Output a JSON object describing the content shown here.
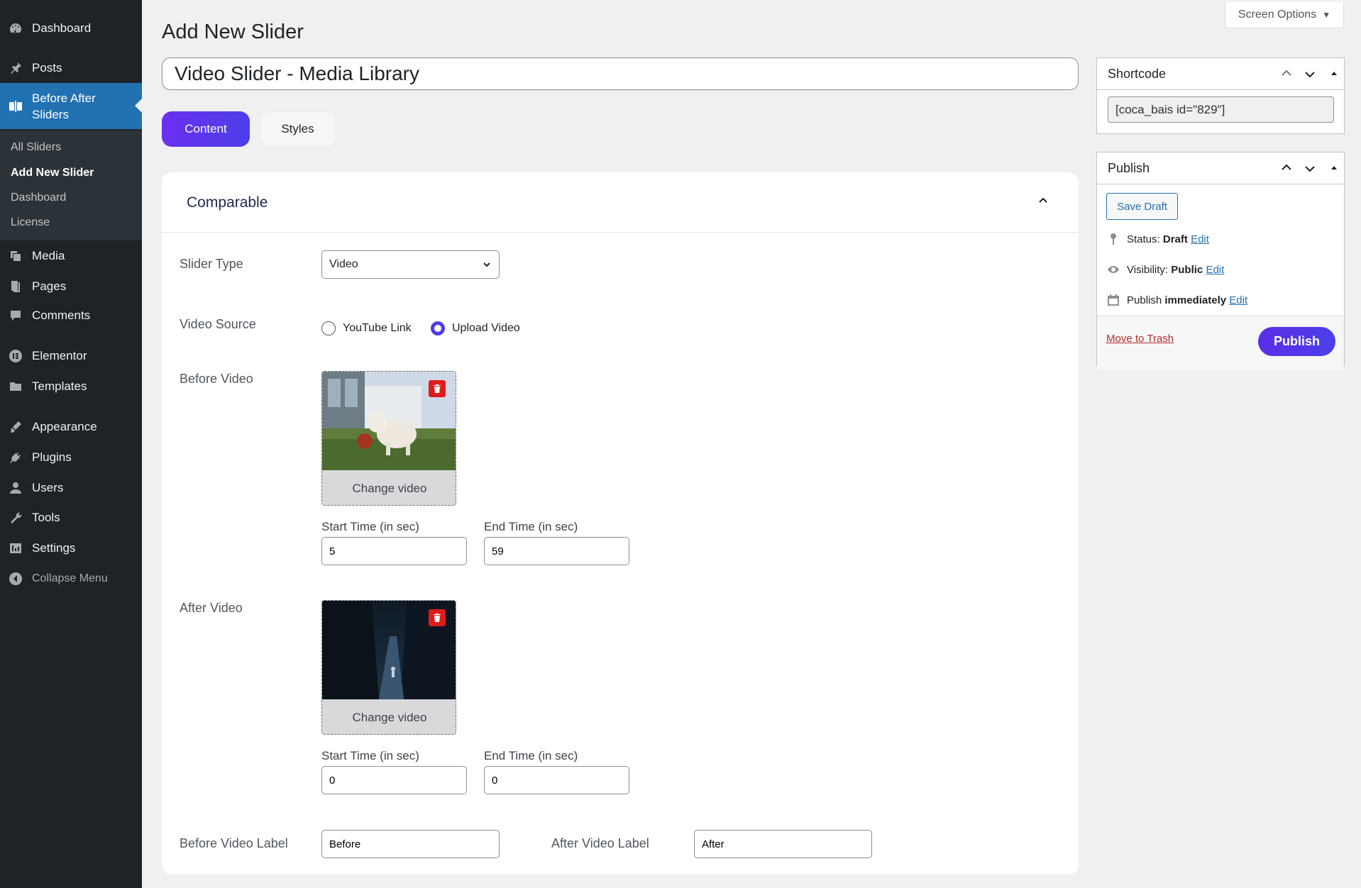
{
  "sidebar": {
    "items": [
      {
        "label": "Dashboard",
        "icon": "dashboard-icon"
      },
      {
        "label": "Posts",
        "icon": "pushpin-icon"
      },
      {
        "label": "Before After Sliders",
        "icon": "before-after-icon"
      },
      {
        "label": "Media",
        "icon": "media-icon"
      },
      {
        "label": "Pages",
        "icon": "pages-icon"
      },
      {
        "label": "Comments",
        "icon": "comment-icon"
      },
      {
        "label": "Elementor",
        "icon": "elementor-icon"
      },
      {
        "label": "Templates",
        "icon": "folder-icon"
      },
      {
        "label": "Appearance",
        "icon": "brush-icon"
      },
      {
        "label": "Plugins",
        "icon": "plugin-icon"
      },
      {
        "label": "Users",
        "icon": "user-icon"
      },
      {
        "label": "Tools",
        "icon": "wrench-icon"
      },
      {
        "label": "Settings",
        "icon": "settings-icon"
      },
      {
        "label": "Collapse Menu",
        "icon": "collapse-icon"
      }
    ],
    "submenu": [
      "All Sliders",
      "Add New Slider",
      "Dashboard",
      "License"
    ]
  },
  "screen_options": "Screen Options",
  "page_title": "Add New Slider",
  "slider_title": "Video Slider - Media Library",
  "tabs": {
    "content": "Content",
    "styles": "Styles"
  },
  "panel": {
    "title": "Comparable",
    "slider_type_label": "Slider Type",
    "slider_type_value": "Video",
    "video_source_label": "Video Source",
    "radio_youtube": "YouTube Link",
    "radio_upload": "Upload Video",
    "before_video_label": "Before Video",
    "after_video_label": "After Video",
    "change_video": "Change video",
    "start_time_label": "Start Time (in sec)",
    "end_time_label": "End Time (in sec)",
    "before_start": "5",
    "before_end": "59",
    "after_start": "0",
    "after_end": "0",
    "before_video_label_field": "Before Video Label",
    "after_video_label_field": "After Video Label",
    "before_label_value": "Before",
    "after_label_value": "After"
  },
  "shortcode": {
    "title": "Shortcode",
    "value": "[coca_bais id=\"829\"]"
  },
  "publish": {
    "title": "Publish",
    "save_draft": "Save Draft",
    "status_label": "Status:",
    "status_value": "Draft",
    "visibility_label": "Visibility:",
    "visibility_value": "Public",
    "publish_label": "Publish",
    "publish_value": "immediately",
    "edit": "Edit",
    "move_to_trash": "Move to Trash",
    "publish_button": "Publish"
  },
  "colors": {
    "accent": "#4b3fe8",
    "wp_blue": "#2271b1",
    "sidebar": "#1d2327"
  }
}
